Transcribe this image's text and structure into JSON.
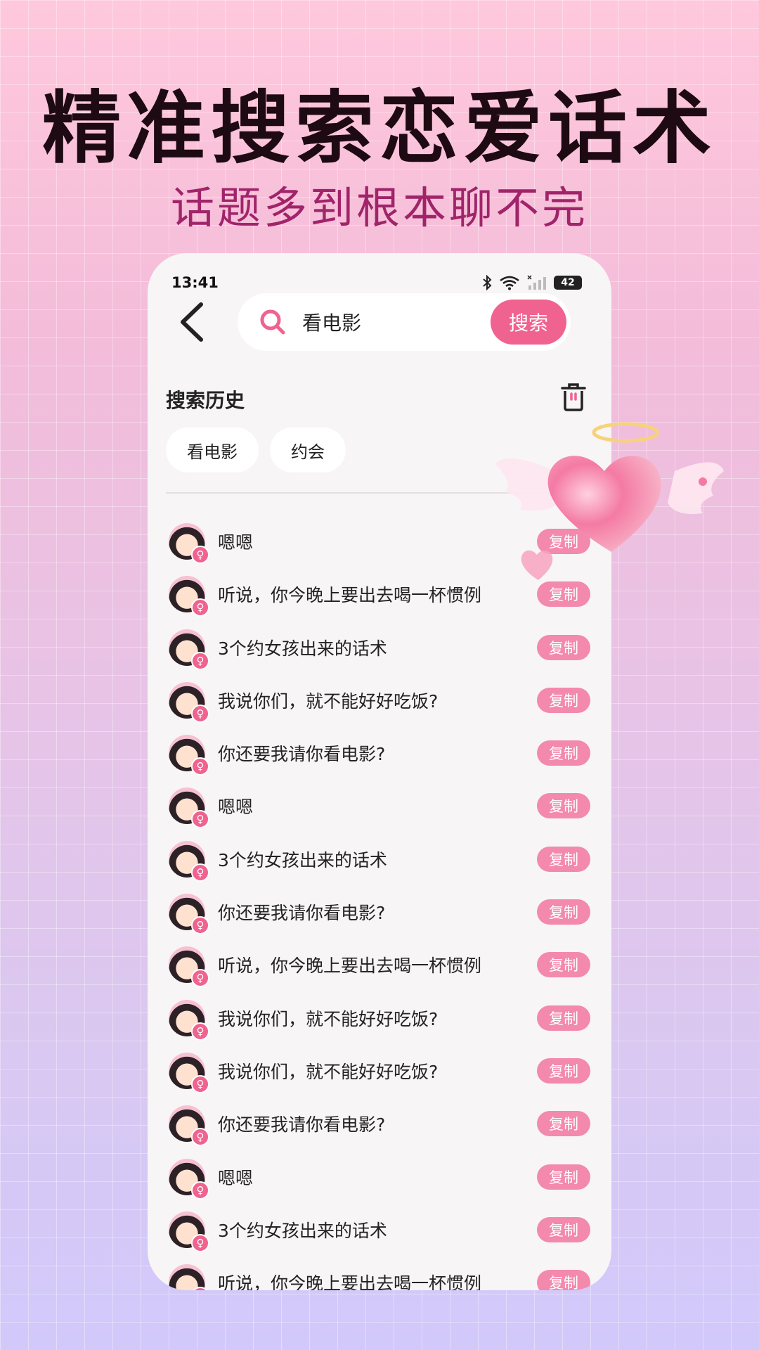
{
  "promo": {
    "headline": "精准搜索恋爱话术",
    "subline": "话题多到根本聊不完"
  },
  "status_bar": {
    "time": "13:41",
    "battery": "42"
  },
  "search": {
    "query": "看电影",
    "button_label": "搜索"
  },
  "history": {
    "title": "搜索历史",
    "chips": [
      "看电影",
      "约会"
    ]
  },
  "results": [
    {
      "text": "嗯嗯",
      "copy": "复制"
    },
    {
      "text": "听说，你今晚上要出去喝一杯惯例",
      "copy": "复制"
    },
    {
      "text": "3个约女孩出来的话术",
      "copy": "复制"
    },
    {
      "text": "我说你们，就不能好好吃饭?",
      "copy": "复制"
    },
    {
      "text": "你还要我请你看电影?",
      "copy": "复制"
    },
    {
      "text": "嗯嗯",
      "copy": "复制"
    },
    {
      "text": "3个约女孩出来的话术",
      "copy": "复制"
    },
    {
      "text": "你还要我请你看电影?",
      "copy": "复制"
    },
    {
      "text": "听说，你今晚上要出去喝一杯惯例",
      "copy": "复制"
    },
    {
      "text": "我说你们，就不能好好吃饭?",
      "copy": "复制"
    },
    {
      "text": "我说你们，就不能好好吃饭?",
      "copy": "复制"
    },
    {
      "text": "你还要我请你看电影?",
      "copy": "复制"
    },
    {
      "text": "嗯嗯",
      "copy": "复制"
    },
    {
      "text": "3个约女孩出来的话术",
      "copy": "复制"
    },
    {
      "text": "听说，你今晚上要出去喝一杯惯例",
      "copy": "复制"
    }
  ],
  "colors": {
    "accent": "#f0628f",
    "copy_button": "#f389ac",
    "subline": "#a0246a"
  }
}
